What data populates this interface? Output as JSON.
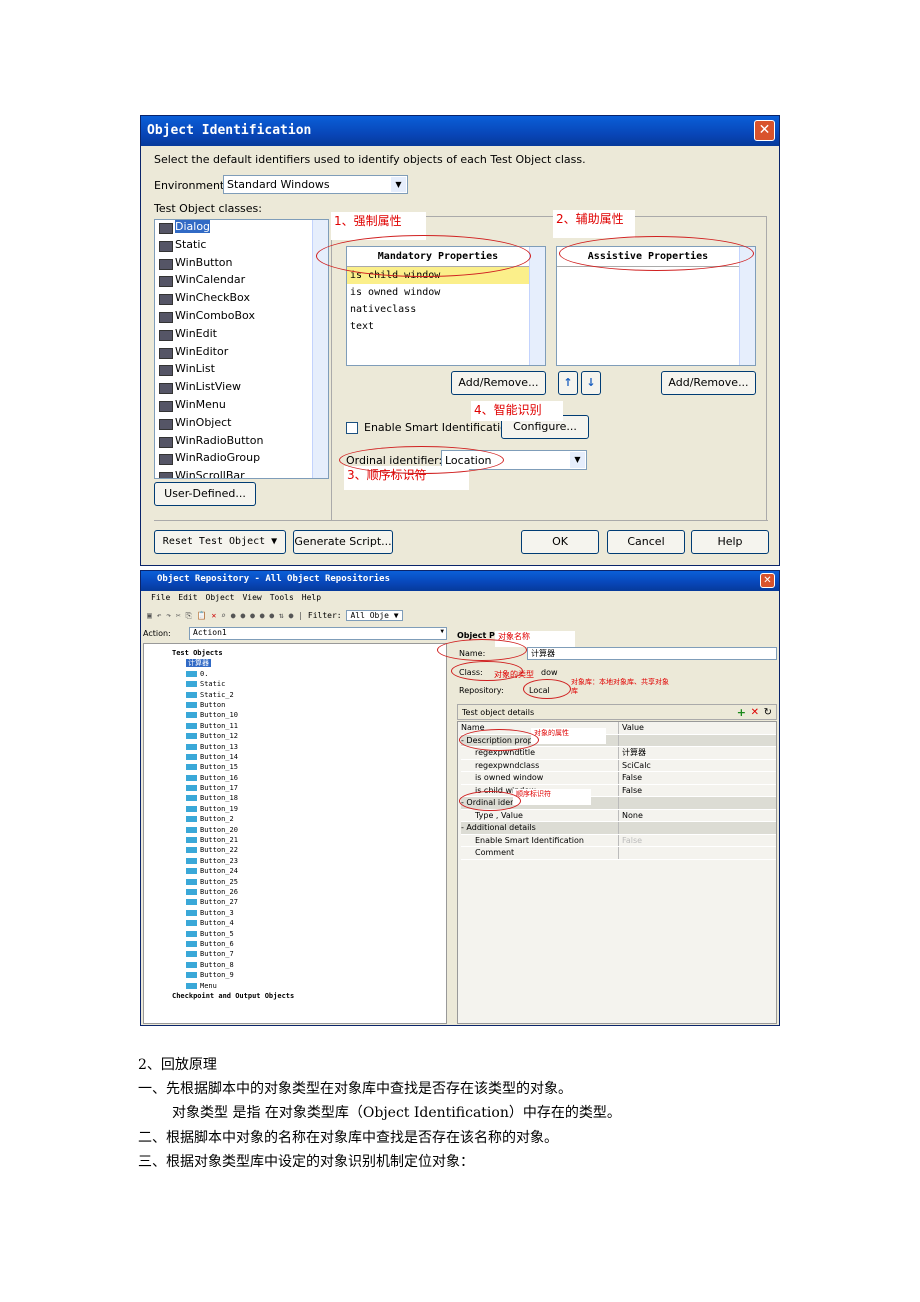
{
  "dialog1": {
    "title": "Object Identification",
    "instruction": "Select the default identifiers used to identify objects of each Test Object class.",
    "environment_label": "Environment:",
    "environment_value": "Standard Windows",
    "classes_label": "Test Object classes:",
    "classes": [
      "Dialog",
      "Static",
      "WinButton",
      "WinCalendar",
      "WinCheckBox",
      "WinComboBox",
      "WinEdit",
      "WinEditor",
      "WinList",
      "WinListView",
      "WinMenu",
      "WinObject",
      "WinRadioButton",
      "WinRadioGroup",
      "WinScrollBar"
    ],
    "mandatory_header": "Mandatory Properties",
    "mandatory": [
      "is child window",
      "is owned window",
      "nativeclass",
      "text"
    ],
    "assistive_header": "Assistive Properties",
    "add_remove": "Add/Remove...",
    "add_remove2": "Add/Remove...",
    "smart_id_label": "Enable Smart Identification",
    "configure": "Configure...",
    "ordinal_label": "Ordinal identifier:",
    "ordinal_value": "Location",
    "user_defined": "User-Defined...",
    "reset": "Reset Test Object",
    "generate": "Generate Script...",
    "ok": "OK",
    "cancel": "Cancel",
    "help": "Help",
    "ann1": "1、强制属性",
    "ann2": "2、辅助属性",
    "ann3": "3、顺序标识符",
    "ann4": "4、智能识别"
  },
  "dialog2": {
    "title": "Object Repository - All Object Repositories",
    "menu": [
      "File",
      "Edit",
      "Object",
      "View",
      "Tools",
      "Help"
    ],
    "filter_label": "Filter:",
    "filter_value": "All Obje",
    "action_label": "Action:",
    "action_value": "Action1",
    "tree_root": "Test Objects",
    "tree_window": "计算器",
    "tree_items": [
      "0.",
      "Static",
      "Static_2",
      "Button",
      "Button_10",
      "Button_11",
      "Button_12",
      "Button_13",
      "Button_14",
      "Button_15",
      "Button_16",
      "Button_17",
      "Button_18",
      "Button_19",
      "Button_2",
      "Button_20",
      "Button_21",
      "Button_22",
      "Button_23",
      "Button_24",
      "Button_25",
      "Button_26",
      "Button_27",
      "Button_3",
      "Button_4",
      "Button_5",
      "Button_6",
      "Button_7",
      "Button_8",
      "Button_9",
      "Menu"
    ],
    "tree_checkpoint": "Checkpoint and Output Objects",
    "props_header": "Object Pr",
    "name_label": "Name:",
    "name_value": "计算器",
    "class_label": "Class:",
    "class_value": "dow",
    "repo_label": "Repository:",
    "repo_value": "Local",
    "details_label": "Test object details",
    "col_name": "Name",
    "col_value": "Value",
    "rows": [
      {
        "n": "- Description properti",
        "v": "",
        "g": true
      },
      {
        "n": "regexpwndtitle",
        "v": "计算器"
      },
      {
        "n": "regexpwndclass",
        "v": "SciCalc"
      },
      {
        "n": "is owned window",
        "v": "False"
      },
      {
        "n": "is child window",
        "v": "False"
      },
      {
        "n": "- Ordinal identif",
        "v": "",
        "g": true
      },
      {
        "n": "Type , Value",
        "v": "None"
      },
      {
        "n": "- Additional details",
        "v": "",
        "g": true
      },
      {
        "n": "Enable Smart Identification",
        "v": "False"
      },
      {
        "n": "Comment",
        "v": ""
      }
    ],
    "ann_name": "对象名称",
    "ann_class": "对象的类型",
    "ann_repo": "对象库：本地对象库、共享对象库",
    "ann_props": "对象的属性",
    "ann_ordinal": "顺序标识符"
  },
  "text": {
    "h": "2、回放原理",
    "l1": "一、先根据脚本中的对象类型在对象库中查找是否存在该类型的对象。",
    "l2": "对象类型 是指 在对象类型库（Object Identification）中存在的类型。",
    "l3": "二、根据脚本中对象的名称在对象库中查找是否存在该名称的对象。",
    "l4": "三、根据对象类型库中设定的对象识别机制定位对象："
  }
}
